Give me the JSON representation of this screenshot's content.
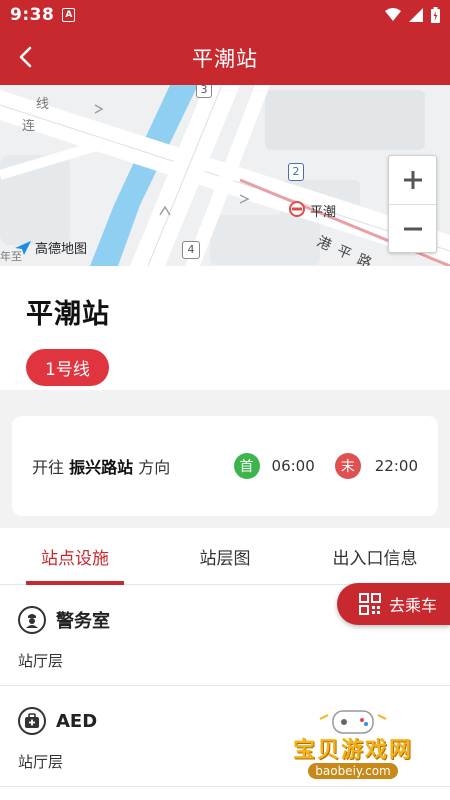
{
  "status_bar": {
    "time": "9:38",
    "notification_badge": "A",
    "icons": [
      "wifi-icon",
      "signal-icon",
      "battery-icon"
    ]
  },
  "header": {
    "title": "平潮站",
    "back_icon": "back-arrow-icon"
  },
  "map": {
    "provider_logo": "高德地图",
    "labels": {
      "road_1": "港平路",
      "poi": "平潮",
      "street_partial": "连",
      "street_partial_2": "线",
      "left_partial": "年至"
    },
    "markers": [
      "3",
      "2",
      "4"
    ],
    "zoom_in": "+",
    "zoom_out": "−"
  },
  "station": {
    "name": "平潮站",
    "line": "1号线"
  },
  "direction": {
    "prefix": "开往",
    "terminal": "振兴路站",
    "suffix": "方向",
    "first_label": "首",
    "first_time": "06:00",
    "last_label": "末",
    "last_time": "22:00"
  },
  "tabs": [
    {
      "label": "站点设施",
      "active": true
    },
    {
      "label": "站层图",
      "active": false
    },
    {
      "label": "出入口信息",
      "active": false
    }
  ],
  "board_button": {
    "label": "去乘车",
    "icon": "qr-code-icon"
  },
  "facilities": [
    {
      "name": "警务室",
      "floor": "站厅层",
      "icon": "police-icon"
    },
    {
      "name": "AED",
      "floor": "站厅层",
      "icon": "medical-kit-icon"
    }
  ],
  "watermark": {
    "text": "宝贝游戏网",
    "url": "baobeiy.com"
  },
  "colors": {
    "brand_red": "#c8292f",
    "line_badge": "#e0343f",
    "first_green": "#3cb54a",
    "last_red": "#e05050"
  }
}
